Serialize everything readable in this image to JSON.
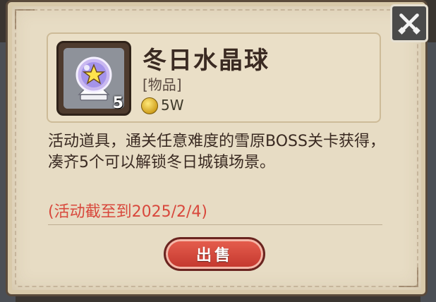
{
  "dialog": {
    "item_name": "冬日水晶球",
    "item_type": "[物品]",
    "item_count": "5",
    "price": "5W",
    "description": "活动道具，通关任意难度的雪原BOSS关卡获得，凑齐5个可以解锁冬日城镇场景。",
    "deadline": "(活动截至到2025/2/4)",
    "sell_label": "出售",
    "close_icon": "close-crossed-swords-icon",
    "coin_icon": "gold-coin-icon",
    "item_icon": "crystal-ball-star-icon"
  },
  "colors": {
    "panel": "#e7dcc4",
    "title_text": "#3a2a22",
    "deadline_text": "#d8483c",
    "sell_button": "#d4473a"
  }
}
